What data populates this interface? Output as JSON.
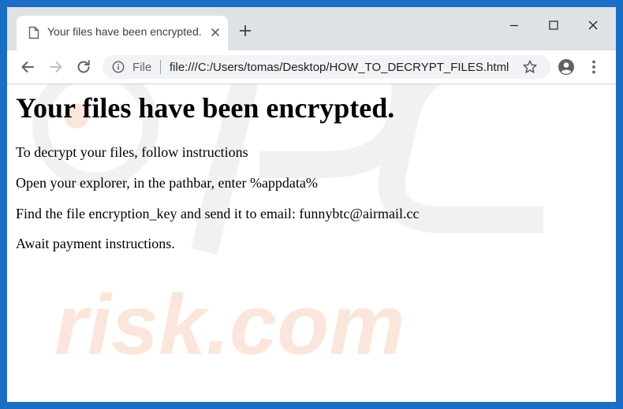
{
  "tab": {
    "title": "Your files have been encrypted."
  },
  "address_bar": {
    "scheme_label": "File",
    "url": "file:///C:/Users/tomas/Desktop/HOW_TO_DECRYPT_FILES.html"
  },
  "page": {
    "heading": "Your files have been encrypted.",
    "paragraphs": [
      "To decrypt your files, follow instructions",
      "Open your explorer, in the pathbar, enter %appdata%",
      "Find the file encryption_key and send it to email: funnybtc@airmail.cc",
      "Await payment instructions."
    ]
  },
  "watermark": {
    "text": "risk.com"
  },
  "colors": {
    "frame": "#1a6fc4",
    "titlebar": "#dee1e6",
    "omnibox": "#f1f3f4",
    "icon": "#5f6368",
    "watermark_gray": "#f0f0f0",
    "watermark_orange": "#fbe6dc"
  },
  "icons": {
    "tab": "document-icon",
    "tab_close": "close-icon",
    "new_tab": "plus-icon",
    "minimize": "minimize-icon",
    "maximize": "maximize-icon",
    "close": "close-icon",
    "back": "arrow-left-icon",
    "forward": "arrow-right-icon",
    "reload": "reload-icon",
    "site_info": "info-icon",
    "bookmark": "star-icon",
    "profile": "account-circle-icon",
    "menu": "kebab-menu-icon"
  }
}
